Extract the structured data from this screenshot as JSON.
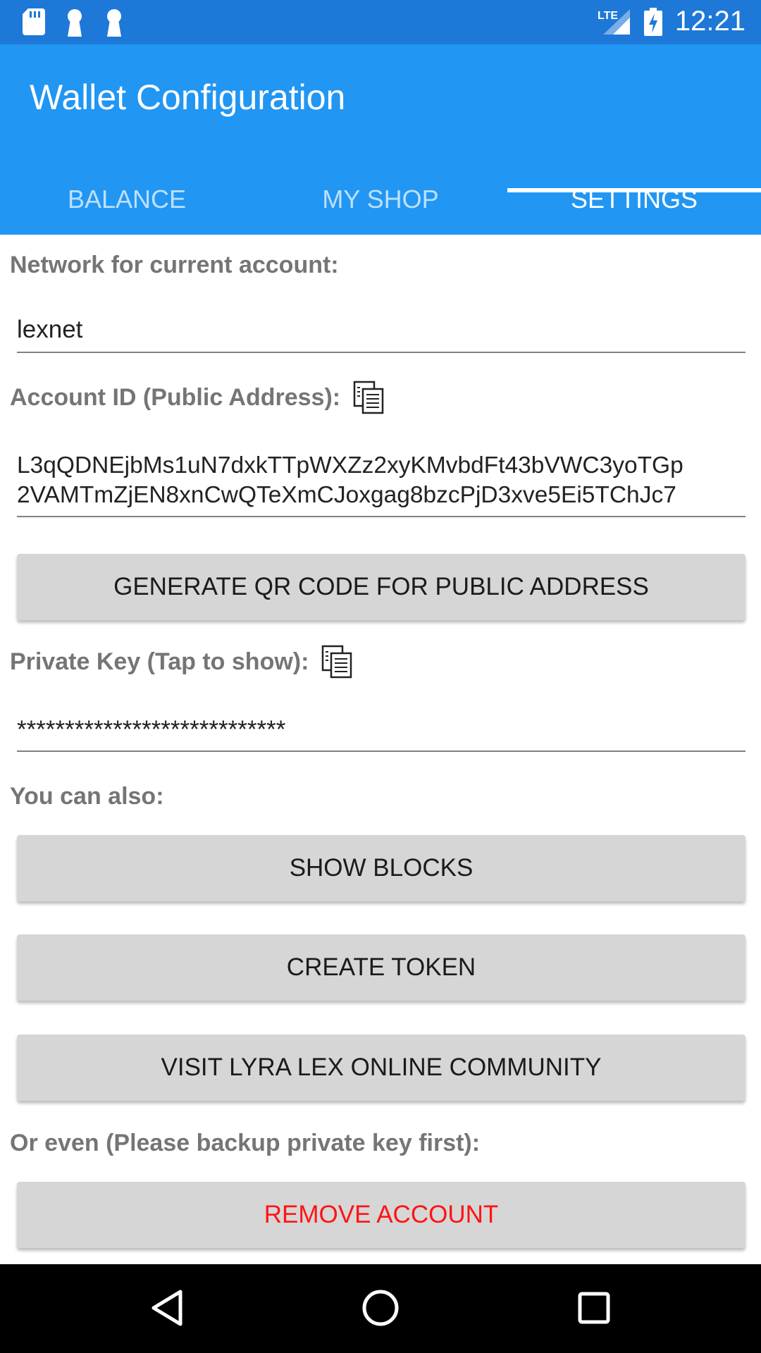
{
  "status_bar": {
    "time": "12:21",
    "network": "LTE",
    "icons": [
      "sd-card-icon",
      "keyhole-icon",
      "keyhole-icon",
      "signal-icon",
      "battery-charging-icon"
    ]
  },
  "app_bar": {
    "title": "Wallet Configuration",
    "tabs": [
      {
        "label": "BALANCE",
        "active": false
      },
      {
        "label": "MY SHOP",
        "active": false
      },
      {
        "label": "SETTINGS",
        "active": true
      }
    ]
  },
  "settings": {
    "network_label": "Network for current account:",
    "network_value": "lexnet",
    "account_label": "Account ID (Public Address):",
    "account_line1": "L3qQDNEjbMs1uN7dxkTTpWXZz2xyKMvbdFt43bVWC3yoTGp",
    "account_line2": "2VAMTmZjEN8xnCwQTeXmCJoxgag8bzcPjD3xve5Ei5TChJc7",
    "qr_button": "GENERATE QR CODE FOR PUBLIC ADDRESS",
    "private_key_label": "Private Key (Tap to show):",
    "private_key_value": "****************************",
    "also_label": "You can also:",
    "show_blocks_button": "SHOW BLOCKS",
    "create_token_button": "CREATE TOKEN",
    "community_button": "VISIT LYRA LEX ONLINE COMMUNITY",
    "backup_label": "Or even (Please backup private key first):",
    "remove_account_button": "REMOVE ACCOUNT"
  },
  "colors": {
    "status_bar": "#1E78D7",
    "app_bar": "#2196F3",
    "danger": "#FF1414",
    "button_bg": "#D6D6D6"
  }
}
